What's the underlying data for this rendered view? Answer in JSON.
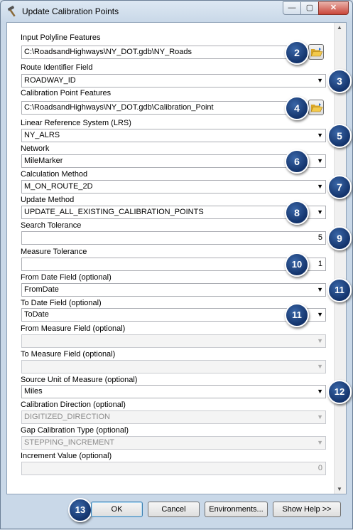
{
  "window": {
    "title": "Update Calibration Points"
  },
  "title_controls": {
    "minimize": "—",
    "maximize": "▢",
    "close": "✕"
  },
  "fields": [
    {
      "label": "Input Polyline Features",
      "value": "C:\\RoadsandHighways\\NY_DOT.gdb\\NY_Roads",
      "badge": "2"
    },
    {
      "label": "Route Identifier Field",
      "value": "ROADWAY_ID",
      "badge": "3"
    },
    {
      "label": "Calibration Point Features",
      "value": "C:\\RoadsandHighways\\NY_DOT.gdb\\Calibration_Point",
      "badge": "4"
    },
    {
      "label": "Linear Reference System (LRS)",
      "value": "NY_ALRS",
      "badge": "5"
    },
    {
      "label": "Network",
      "value": "MileMarker",
      "badge": "6"
    },
    {
      "label": "Calculation Method",
      "value": "M_ON_ROUTE_2D",
      "badge": "7"
    },
    {
      "label": "Update Method",
      "value": "UPDATE_ALL_EXISTING_CALIBRATION_POINTS",
      "badge": "8"
    },
    {
      "label": "Search Tolerance",
      "value": "5",
      "badge": "9"
    },
    {
      "label": "Measure Tolerance",
      "value": "1",
      "badge": "10"
    },
    {
      "label": "From Date Field (optional)",
      "value": "FromDate",
      "badge": "11"
    },
    {
      "label": "To Date Field (optional)",
      "value": "ToDate",
      "badge": "11"
    },
    {
      "label": "From Measure Field (optional)",
      "value": ""
    },
    {
      "label": "To Measure Field (optional)",
      "value": ""
    },
    {
      "label": "Source Unit of Measure (optional)",
      "value": "Miles",
      "badge": "12"
    },
    {
      "label": "Calibration Direction (optional)",
      "value": "DIGITIZED_DIRECTION"
    },
    {
      "label": "Gap Calibration Type (optional)",
      "value": "STEPPING_INCREMENT"
    },
    {
      "label": "Increment Value (optional)",
      "value": "0"
    }
  ],
  "buttons": {
    "badge": "13",
    "ok": "OK",
    "cancel": "Cancel",
    "environments": "Environments...",
    "help": "Show Help >>"
  },
  "colors": {
    "badge": "#1c3f7a",
    "window_frame": "#c9d8e8",
    "field_border": "#abadb3"
  },
  "icons": [
    "hammer-icon",
    "folder-open-icon",
    "dropdown-arrow-icon"
  ]
}
